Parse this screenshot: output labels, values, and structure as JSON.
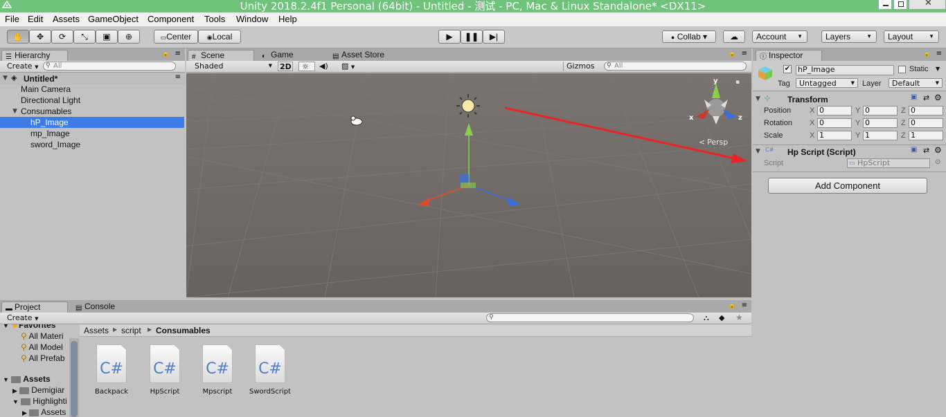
{
  "title": "Unity 2018.2.4f1 Personal (64bit) - Untitled - 测试 - PC, Mac & Linux Standalone* <DX11>",
  "menu": [
    "File",
    "Edit",
    "Assets",
    "GameObject",
    "Component",
    "Tools",
    "Window",
    "Help"
  ],
  "toolbar": {
    "center": "Center",
    "local": "Local",
    "collab": "Collab ▾",
    "account": "Account",
    "layers": "Layers",
    "layout": "Layout"
  },
  "hierarchy": {
    "tab": "Hierarchy",
    "create": "Create",
    "search": "All",
    "scene": "Untitled*",
    "items": [
      "Main Camera",
      "Directional Light",
      "Consumables",
      "hP_Image",
      "mp_Image",
      "sword_Image"
    ]
  },
  "sceneview": {
    "tabs": [
      "Scene",
      "Game",
      "Asset Store"
    ],
    "shading": "Shaded",
    "mode2d": "2D",
    "gizmos": "Gizmos",
    "search": "All",
    "persp": "Persp",
    "axis_x": "x",
    "axis_y": "y",
    "axis_z": "z"
  },
  "project": {
    "tabs": [
      "Project",
      "Console"
    ],
    "create": "Create",
    "favorites_label": "Favorites",
    "favorites": [
      "All Materi",
      "All Model",
      "All Prefab"
    ],
    "assets_label": "Assets",
    "assets_tree": [
      "Demigiar",
      "Highlighti",
      "Assets"
    ],
    "breadcrumb": [
      "Assets",
      "script",
      "Consumables"
    ],
    "files": [
      "Backpack",
      "HpScript",
      "Mpscript",
      "SwordScript"
    ],
    "file_icon": "C#"
  },
  "inspector": {
    "tab": "Inspector",
    "name": "hP_Image",
    "static": "Static",
    "tag_label": "Tag",
    "tag": "Untagged",
    "layer_label": "Layer",
    "layer": "Default",
    "transform": {
      "title": "Transform",
      "rows": [
        {
          "label": "Position",
          "x": "0",
          "y": "0",
          "z": "0"
        },
        {
          "label": "Rotation",
          "x": "0",
          "y": "0",
          "z": "0"
        },
        {
          "label": "Scale",
          "x": "1",
          "y": "1",
          "z": "1"
        }
      ]
    },
    "script_comp": {
      "title": "Hp Script (Script)",
      "label": "Script",
      "value": "HpScript"
    },
    "add_component": "Add Component"
  },
  "colors": {
    "title_bg": "#6fc37a",
    "selection": "#3e7de7",
    "scene_bg": "#6b6560",
    "arrow": "#e82424"
  }
}
